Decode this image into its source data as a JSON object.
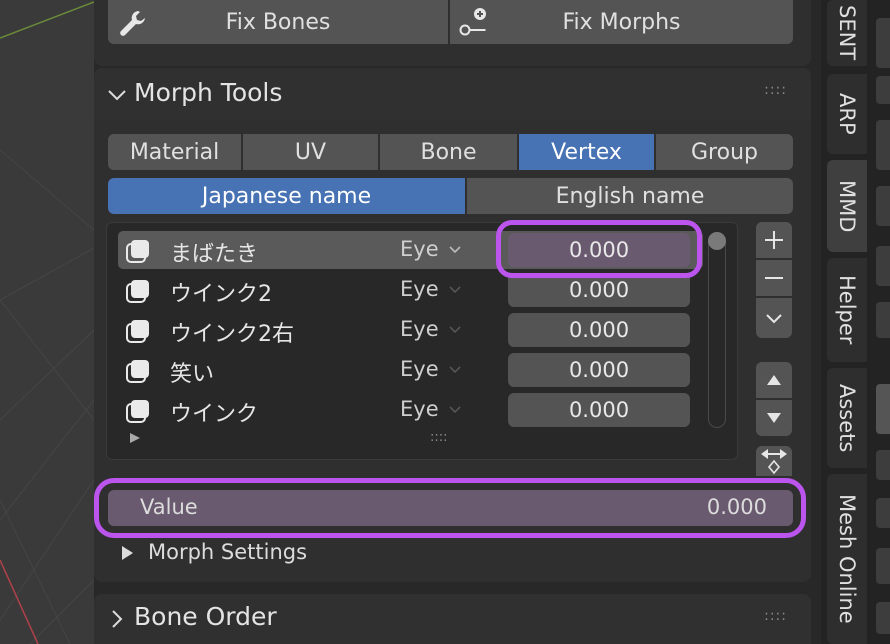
{
  "fix_buttons": {
    "fix_bones": "Fix Bones",
    "fix_morphs": "Fix Morphs"
  },
  "morph_tools": {
    "title": "Morph Tools",
    "type_tabs": [
      "Material",
      "UV",
      "Bone",
      "Vertex",
      "Group"
    ],
    "active_type": "Vertex",
    "name_tabs": [
      "Japanese name",
      "English name"
    ],
    "active_name_tab": "Japanese name",
    "morphs": [
      {
        "name": "まばたき",
        "category": "Eye",
        "value": "0.000",
        "selected": true
      },
      {
        "name": "ウインク2",
        "category": "Eye",
        "value": "0.000",
        "selected": false
      },
      {
        "name": "ウインク2右",
        "category": "Eye",
        "value": "0.000",
        "selected": false
      },
      {
        "name": "笑い",
        "category": "Eye",
        "value": "0.000",
        "selected": false
      },
      {
        "name": "ウインク",
        "category": "Eye",
        "value": "0.000",
        "selected": false
      }
    ],
    "value_label": "Value",
    "value": "0.000",
    "morph_settings": "Morph Settings"
  },
  "bone_order": {
    "title": "Bone Order"
  },
  "side_tabs": [
    "SENT",
    "ARP",
    "MMD",
    "Helper",
    "Assets",
    "Mesh Online"
  ],
  "active_side_tab": "MMD",
  "colors": {
    "accent": "#4772b3",
    "highlight_ring": "#bb55ee"
  }
}
